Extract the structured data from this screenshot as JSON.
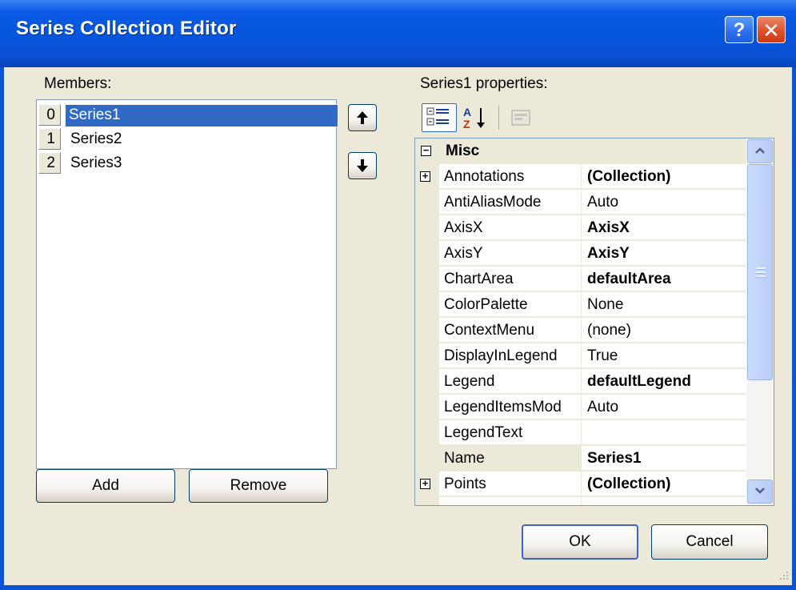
{
  "window": {
    "title": "Series Collection Editor",
    "help_glyph": "?",
    "close_glyph": "✕"
  },
  "members": {
    "label": "Members:",
    "items": [
      {
        "index": "0",
        "name": "Series1"
      },
      {
        "index": "1",
        "name": "Series2"
      },
      {
        "index": "2",
        "name": "Series3"
      }
    ],
    "selected_index": 0,
    "add_label": "Add",
    "remove_label": "Remove",
    "move_up_glyph": "🡅",
    "move_down_glyph": "🡇"
  },
  "properties": {
    "label": "Series1 properties:",
    "category": "Misc",
    "rows": [
      {
        "name": "Annotations",
        "value": "(Collection)",
        "bold": true,
        "expandable": true
      },
      {
        "name": "AntiAliasMode",
        "value": "Auto",
        "bold": false
      },
      {
        "name": "AxisX",
        "value": "AxisX",
        "bold": true
      },
      {
        "name": "AxisY",
        "value": "AxisY",
        "bold": true
      },
      {
        "name": "ChartArea",
        "value": "defaultArea",
        "bold": true
      },
      {
        "name": "ColorPalette",
        "value": "None",
        "bold": false
      },
      {
        "name": "ContextMenu",
        "value": "(none)",
        "bold": false
      },
      {
        "name": "DisplayInLegend",
        "value": "True",
        "bold": false
      },
      {
        "name": "Legend",
        "value": "defaultLegend",
        "bold": true
      },
      {
        "name": "LegendItemsMod",
        "value": "Auto",
        "bold": false
      },
      {
        "name": "LegendText",
        "value": "",
        "bold": false
      },
      {
        "name": "Name",
        "value": "Series1",
        "bold": true,
        "selected": true
      },
      {
        "name": "Points",
        "value": "(Collection)",
        "bold": true,
        "expandable": true
      }
    ],
    "toolbar": {
      "categorized_icon": "categorized-icon",
      "alphabetical_icon": "alphabetical-icon",
      "property_pages_icon": "property-pages-icon"
    }
  },
  "footer": {
    "ok_label": "OK",
    "cancel_label": "Cancel"
  },
  "colors": {
    "titlebar": "#0a5ae6",
    "selection": "#316ac5",
    "face": "#ece9d8"
  }
}
